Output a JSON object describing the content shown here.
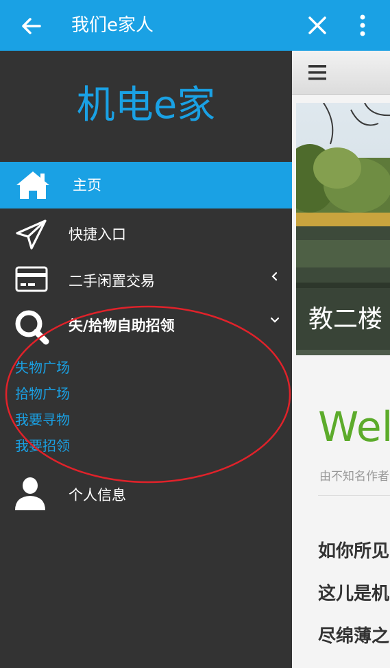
{
  "appbar": {
    "title": "我们e家人",
    "back_icon": "arrow-left-icon",
    "close_icon": "close-icon",
    "more_icon": "more-vertical-icon"
  },
  "drawer": {
    "brand": "机电e家",
    "items": [
      {
        "label": "主页",
        "icon": "home-icon",
        "active": true
      },
      {
        "label": "快捷入口",
        "icon": "paper-plane-icon"
      },
      {
        "label": "二手闲置交易",
        "icon": "credit-card-icon",
        "chevron": "chevron-left-icon"
      },
      {
        "label": "失/拾物自助招领",
        "icon": "search-icon",
        "chevron": "chevron-down-icon"
      },
      {
        "label": "个人信息",
        "icon": "user-icon"
      }
    ],
    "subitems": [
      "失物广场",
      "拾物广场",
      "我要寻物",
      "我要招领"
    ]
  },
  "content": {
    "menu_icon": "hamburger-menu-icon",
    "photo_caption": "教二楼",
    "welcome": "Wel",
    "author": "由不知名作者",
    "paragraphs": [
      "如你所见",
      "这儿是机",
      "尽绵薄之"
    ]
  },
  "colors": {
    "accent": "#1aa1e4",
    "drawer_bg": "#333333",
    "welcome_green": "#5cab2b",
    "annotation_red": "#e0222a"
  }
}
